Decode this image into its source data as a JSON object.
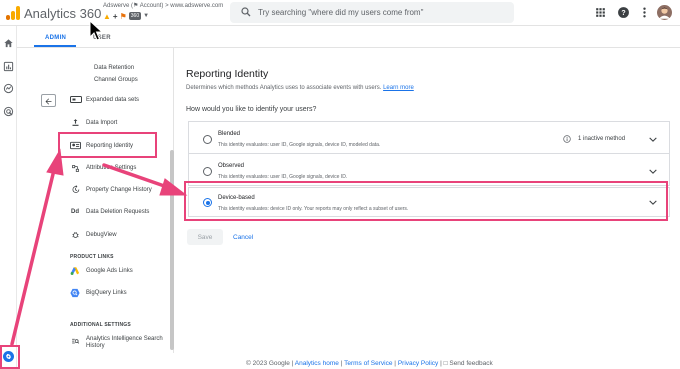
{
  "header": {
    "app_title": "Analytics 360",
    "account_line": "Adswerve (⚑ Account) > www.adswerve.com",
    "property_badge": "360",
    "search_placeholder": "Try searching \"where did my users come from\"",
    "icons": [
      "analytics-logo",
      "search-icon",
      "apps-icon",
      "help-icon",
      "more-icon",
      "avatar"
    ]
  },
  "rail": {
    "icons": [
      "home-icon",
      "reports-icon",
      "explore-icon",
      "advertising-icon",
      "admin-gear-icon"
    ]
  },
  "tabs": {
    "admin": "ADMIN",
    "user": "USER"
  },
  "nav": {
    "items": {
      "data_retention": "Data Retention",
      "channel_groups": "Channel Groups",
      "expanded_data_sets": "Expanded data sets",
      "data_import": "Data Import",
      "reporting_identity": "Reporting Identity",
      "attribution_settings": "Attribution Settings",
      "property_change_history": "Property Change History",
      "data_deletion_requests": "Data Deletion Requests",
      "debugview": "DebugView",
      "google_ads_links": "Google Ads Links",
      "bigquery_links": "BigQuery Links",
      "analytics_intelligence_1": "Analytics Intelligence Search",
      "analytics_intelligence_2": "History"
    },
    "dd_abbrev": "Dd",
    "section_product_links": "PRODUCT LINKS",
    "section_additional": "ADDITIONAL SETTINGS"
  },
  "main": {
    "title": "Reporting Identity",
    "description": "Determines which methods Analytics uses to associate events with users.",
    "learn_more": "Learn more",
    "question": "How would you like to identify your users?",
    "options": [
      {
        "title": "Blended",
        "desc": "This identity evaluates: user ID, Google signals, device ID, modeled data.",
        "note": "1 inactive method",
        "selected": false
      },
      {
        "title": "Observed",
        "desc": "This identity evaluates: user ID, Google signals, device ID.",
        "selected": false
      },
      {
        "title": "Device-based",
        "desc": "This identity evaluates: device ID only. Your reports may only reflect a subset of users.",
        "selected": true
      }
    ],
    "save_label": "Save",
    "cancel_label": "Cancel"
  },
  "footer": {
    "copyright": "© 2023 Google |",
    "analytics_home": "Analytics home",
    "sep1": "|",
    "terms": "Terms of Service",
    "sep2": "|",
    "privacy": "Privacy Policy",
    "sep3": "|",
    "feedback": "Send feedback"
  },
  "colors": {
    "accent": "#1a73e8",
    "highlight": "#e8437a",
    "logo_orange": "#f9ab00",
    "logo_dark_orange": "#e37400"
  }
}
